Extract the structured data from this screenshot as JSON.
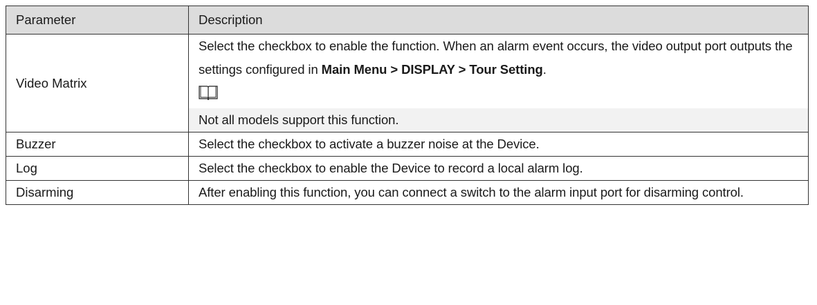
{
  "table": {
    "headers": [
      "Parameter",
      "Description"
    ],
    "rows": [
      {
        "parameter": "Video Matrix",
        "desc_part1": "Select the checkbox to enable the function. When an alarm event occurs, the video output port outputs the settings configured in ",
        "desc_bold": "Main Menu > DISPLAY > Tour Setting",
        "desc_end": ".",
        "note_icon": "book-note-icon",
        "note": "Not all models support this function."
      },
      {
        "parameter": "Buzzer",
        "description": "Select the checkbox to activate a buzzer noise at the Device."
      },
      {
        "parameter": "Log",
        "description": "Select the checkbox to enable the Device to record a local alarm log."
      },
      {
        "parameter": "Disarming",
        "description": "After enabling this function, you can connect a switch to the alarm input port for disarming control."
      }
    ]
  }
}
